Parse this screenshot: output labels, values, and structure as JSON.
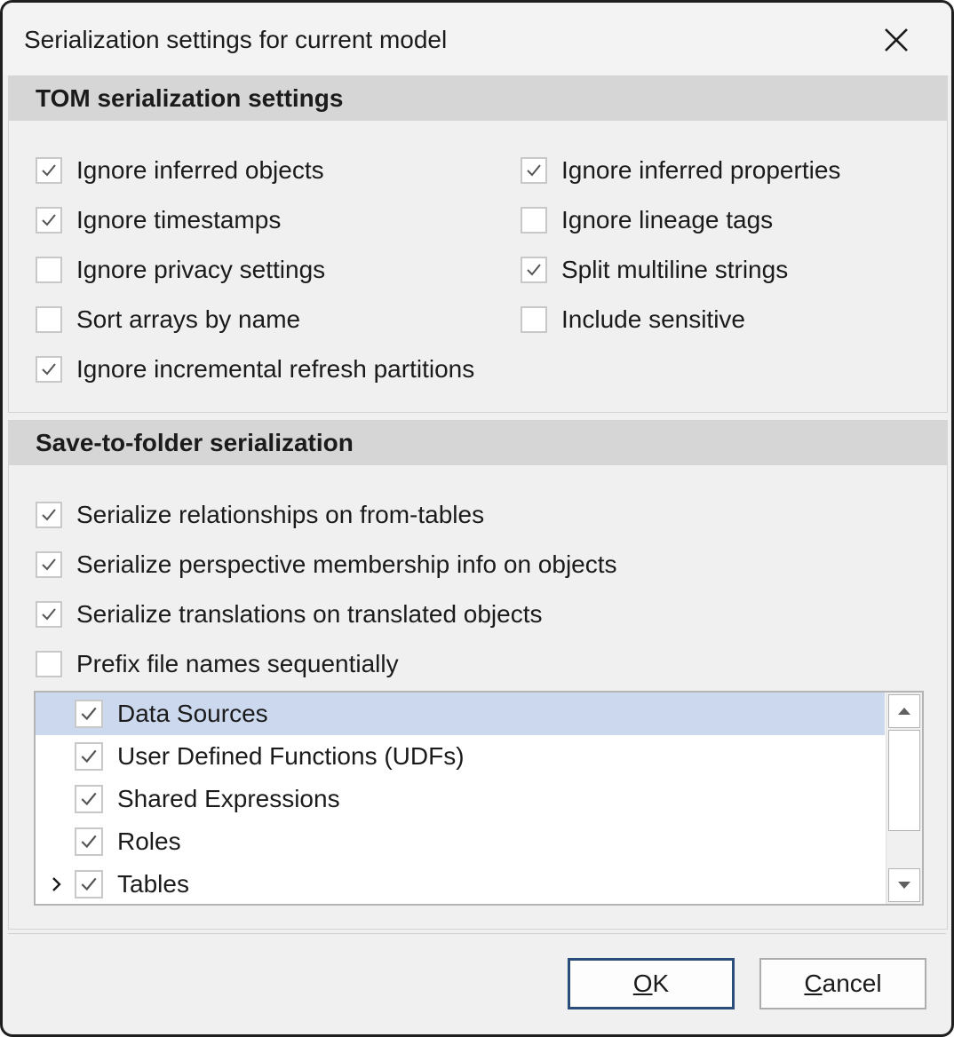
{
  "window": {
    "title": "Serialization settings for current model"
  },
  "tom_section": {
    "header": "TOM serialization settings",
    "options": [
      {
        "label": "Ignore inferred objects",
        "checked": true
      },
      {
        "label": "Ignore inferred properties",
        "checked": true
      },
      {
        "label": "Ignore timestamps",
        "checked": true
      },
      {
        "label": "Ignore lineage tags",
        "checked": false
      },
      {
        "label": "Ignore privacy settings",
        "checked": false
      },
      {
        "label": "Split multiline strings",
        "checked": true
      },
      {
        "label": "Sort arrays by name",
        "checked": false
      },
      {
        "label": "Include sensitive",
        "checked": false
      },
      {
        "label": "Ignore incremental refresh partitions",
        "checked": true
      }
    ]
  },
  "folder_section": {
    "header": "Save-to-folder serialization",
    "options": [
      {
        "label": "Serialize relationships on from-tables",
        "checked": true
      },
      {
        "label": "Serialize perspective membership info on objects",
        "checked": true
      },
      {
        "label": "Serialize translations on translated objects",
        "checked": true
      },
      {
        "label": "Prefix file names sequentially",
        "checked": false
      }
    ],
    "tree_items": [
      {
        "label": "Data Sources",
        "checked": true,
        "selected": true,
        "expandable": false
      },
      {
        "label": "User Defined Functions (UDFs)",
        "checked": true,
        "selected": false,
        "expandable": false
      },
      {
        "label": "Shared Expressions",
        "checked": true,
        "selected": false,
        "expandable": false
      },
      {
        "label": "Roles",
        "checked": true,
        "selected": false,
        "expandable": false
      },
      {
        "label": "Tables",
        "checked": true,
        "selected": false,
        "expandable": true
      }
    ]
  },
  "buttons": {
    "ok_mnemonic": "O",
    "ok_rest": "K",
    "cancel_mnemonic": "C",
    "cancel_rest": "ancel"
  },
  "colors": {
    "selection": "#ccd8ee",
    "section_header": "#d6d6d6",
    "default_button_border": "#2a4d7a"
  }
}
